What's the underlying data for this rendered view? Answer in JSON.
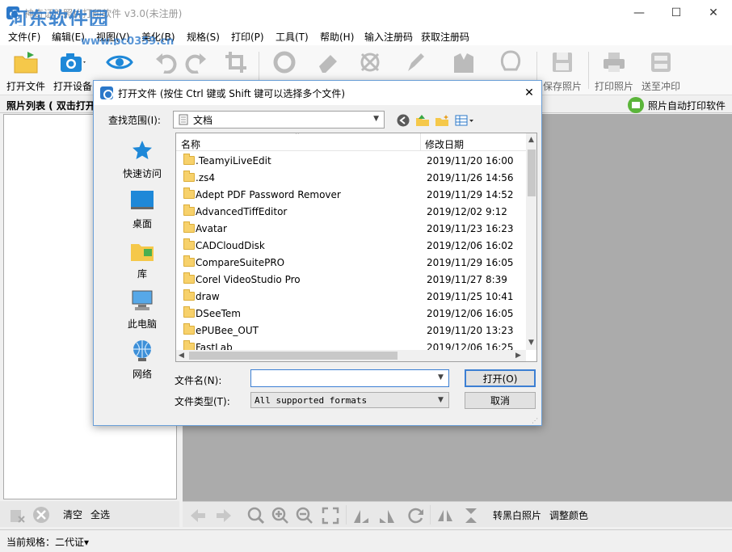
{
  "window": {
    "title": "神奇证件照片打印软件 v3.0(未注册)",
    "watermark_text": "河东软件园",
    "watermark_url": "www.pc0359.cn",
    "minimize": "—",
    "maximize": "☐",
    "close": "✕"
  },
  "menu": [
    {
      "label": "文件(F)"
    },
    {
      "label": "编辑(E)"
    },
    {
      "label": "视图(V)"
    },
    {
      "label": "美化(B)"
    },
    {
      "label": "规格(S)"
    },
    {
      "label": "打印(P)"
    },
    {
      "label": "工具(T)"
    },
    {
      "label": "帮助(H)"
    },
    {
      "label": "输入注册码"
    },
    {
      "label": "获取注册码"
    }
  ],
  "toolbar": {
    "open_file": "打开文件",
    "open_device": "打开设备",
    "save_photo": "保存照片",
    "print_photo": "打印照片",
    "send_print": "送至冲印"
  },
  "panel": {
    "photo_list_title": "照片列表 ( 双击打开",
    "auto_print": "照片自动打印软件"
  },
  "bottom": {
    "clear": "清空",
    "select_all": "全选",
    "to_bw": "转黑白照片",
    "adjust_color": "调整颜色"
  },
  "status": {
    "current_spec": "当前规格：二代证▾"
  },
  "dialog": {
    "title": "打开文件 (按住 Ctrl 键或 Shift 键可以选择多个文件)",
    "close": "✕",
    "look_in_label": "查找范围(I):",
    "look_in_value": "文档",
    "places": [
      {
        "label": "快速访问",
        "icon": "star-icon"
      },
      {
        "label": "桌面",
        "icon": "desktop-icon"
      },
      {
        "label": "库",
        "icon": "library-icon"
      },
      {
        "label": "此电脑",
        "icon": "computer-icon"
      },
      {
        "label": "网络",
        "icon": "network-icon"
      }
    ],
    "columns": {
      "name": "名称",
      "date": "修改日期"
    },
    "files": [
      {
        "name": ".TeamyiLiveEdit",
        "date": "2019/11/20 16:00"
      },
      {
        "name": ".zs4",
        "date": "2019/11/26 14:56"
      },
      {
        "name": "Adept PDF Password Remover",
        "date": "2019/11/29 14:52"
      },
      {
        "name": "AdvancedTiffEditor",
        "date": "2019/12/02 9:12"
      },
      {
        "name": "Avatar",
        "date": "2019/11/23 16:23"
      },
      {
        "name": "CADCloudDisk",
        "date": "2019/12/06 16:02"
      },
      {
        "name": "CompareSuitePRO",
        "date": "2019/11/29 16:05"
      },
      {
        "name": "Corel VideoStudio Pro",
        "date": "2019/11/27 8:39"
      },
      {
        "name": "draw",
        "date": "2019/11/25 10:41"
      },
      {
        "name": "DSeeTem",
        "date": "2019/12/06 16:05"
      },
      {
        "name": "ePUBee_OUT",
        "date": "2019/11/20 13:23"
      },
      {
        "name": "FastLab",
        "date": "2019/12/06 16:25"
      }
    ],
    "filename_label": "文件名(N):",
    "filename_value": "",
    "filetype_label": "文件类型(T):",
    "filetype_value": "All supported formats",
    "open_button": "打开(O)",
    "cancel_button": "取消"
  },
  "colors": {
    "accent": "#3c7fd3",
    "canvas": "#ababab",
    "folder": "#f7d16b"
  }
}
